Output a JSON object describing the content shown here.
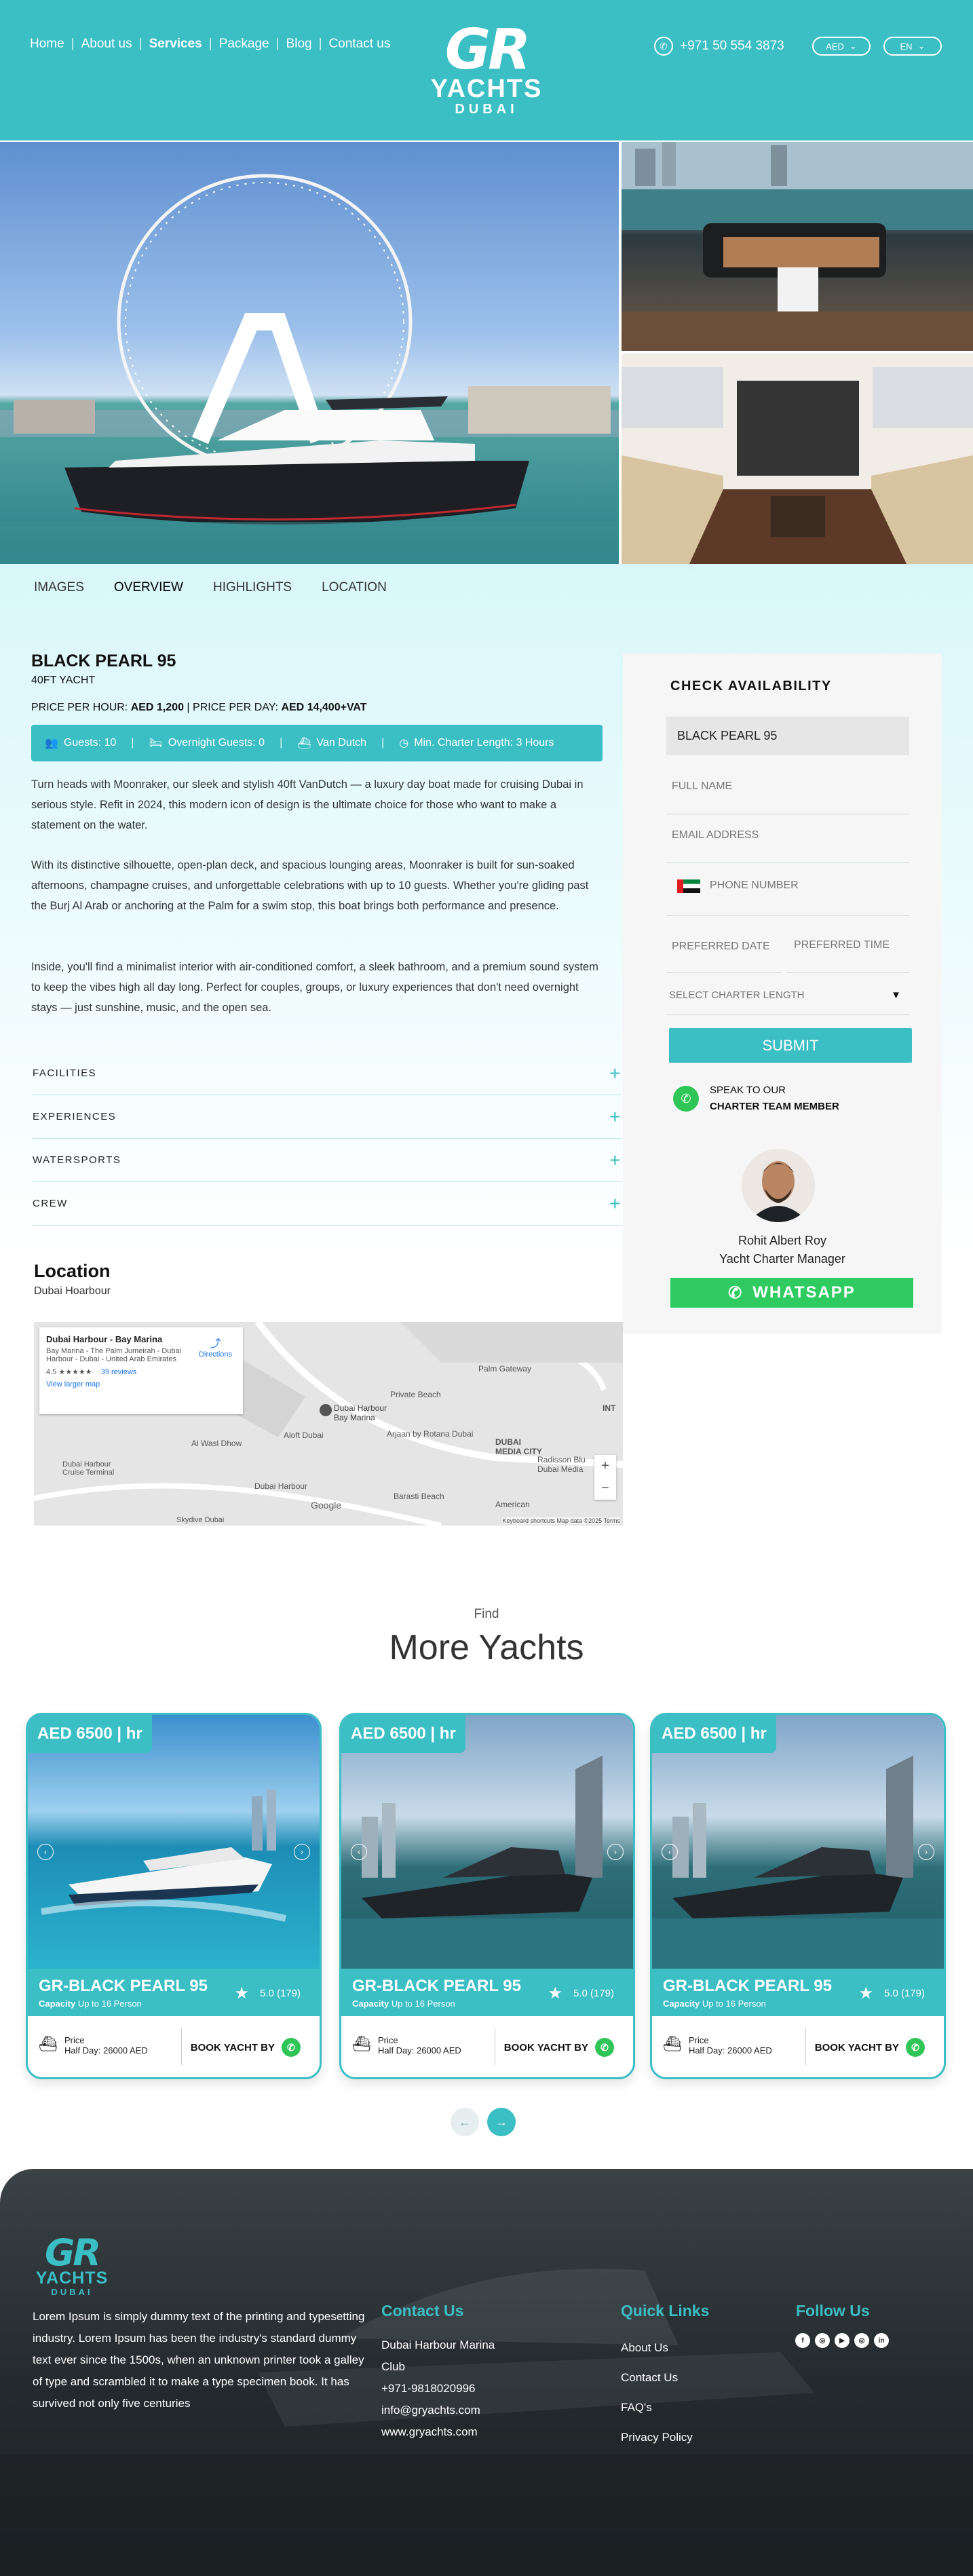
{
  "header": {
    "nav": [
      "Home",
      "About us",
      "Services",
      "Package",
      "Blog",
      "Contact us"
    ],
    "logo": {
      "mark": "GR",
      "line1": "YACHTS",
      "line2": "DUBAI"
    },
    "phone": "+971 50 554 3873",
    "currency": "AED",
    "language": "EN"
  },
  "tabs": [
    "IMAGES",
    "OVERVIEW",
    "HIGHLIGHTS",
    "LOCATION"
  ],
  "yacht": {
    "name": "BLACK PEARL 95",
    "length": "40FT YACHT",
    "price_hour_label": "PRICE PER HOUR:",
    "price_hour": "AED 1,200",
    "price_day_label": "PRICE PER DAY:",
    "price_day": "AED 14,400+VAT",
    "specs": [
      "Guests: 10",
      "Overnight Guests: 0",
      "Van Dutch",
      "Min. Charter Length: 3 Hours"
    ],
    "paragraphs": [
      "Turn heads with Moonraker, our sleek and stylish 40ft VanDutch — a luxury day boat made for cruising Dubai in serious style. Refit in 2024, this modern icon of design is the ultimate choice for those who want to make a statement on the water.",
      "With its distinctive silhouette, open-plan deck, and spacious lounging areas, Moonraker is built for sun-soaked afternoons, champagne cruises, and unforgettable celebrations with up to 10 guests. Whether you're gliding past the Burj Al Arab or anchoring at the Palm for a swim stop, this boat brings both performance and presence.",
      "Inside, you'll find a minimalist interior with air-conditioned comfort, a sleek bathroom, and a premium sound system to keep the vibes high all day long. Perfect for couples, groups, or luxury experiences that don't need overnight stays — just sunshine, music, and the open sea."
    ]
  },
  "accordion": [
    "FACILITIES",
    "EXPERIENCES",
    "WATERSPORTS",
    "CREW"
  ],
  "location": {
    "title": "Location",
    "subtitle": "Dubai Hoarbour",
    "map": {
      "place": "Dubai Harbour - Bay Marina",
      "address": "Bay Marina - The Palm Jumeirah - Dubai Harbour - Dubai - United Arab Emirates",
      "rating": "4.5 ★★★★★",
      "reviews": "39 reviews",
      "directions": "Directions",
      "larger": "View larger map",
      "labels": [
        "Palm Gateway",
        "Private Beach",
        "Dubai Harbour Bay Marina",
        "Al Wasl Dhow",
        "Aloft Dubai",
        "Dubai Harbour Cruise Terminal",
        "Arjaan by Rotana Dubai",
        "DUBAI MEDIA CITY",
        "Radisson Blu Dubai Media",
        "Dubai Harbour",
        "Barasti Beach",
        "Google",
        "American",
        "Skydive Dubai",
        "INT"
      ],
      "footer": "Keyboard shortcuts   Map data ©2025   Terms"
    }
  },
  "booking": {
    "heading": "CHECK AVAILABILITY",
    "selected_yacht": "BLACK PEARL 95",
    "full_name": "FULL NAME",
    "email": "EMAIL ADDRESS",
    "phone": "PHONE NUMBER",
    "date": "PREFERRED DATE",
    "time": "PREFERRED TIME",
    "length": "SELECT CHARTER LENGTH",
    "submit": "SUBMIT",
    "speak1": "SPEAK TO OUR",
    "speak2": "CHARTER TEAM MEMBER",
    "agent_name": "Rohit Albert Roy",
    "agent_role": "Yacht Charter Manager",
    "whatsapp": "WHATSAPP"
  },
  "more": {
    "kicker": "Find",
    "title": "More Yachts",
    "cards": [
      {
        "badge": "AED 6500 | hr",
        "name": "GR-BLACK PEARL 95",
        "cap_label": "Capacity",
        "cap": "Up to 16 Person",
        "rating": "5.0 (179)",
        "price_label": "Price",
        "price": "Half Day: 26000 AED",
        "book": "BOOK YACHT BY"
      },
      {
        "badge": "AED 6500 | hr",
        "name": "GR-BLACK PEARL 95",
        "cap_label": "Capacity",
        "cap": "Up to 16 Person",
        "rating": "5.0 (179)",
        "price_label": "Price",
        "price": "Half Day: 26000 AED",
        "book": "BOOK YACHT BY"
      },
      {
        "badge": "AED 6500 | hr",
        "name": "GR-BLACK PEARL 95",
        "cap_label": "Capacity",
        "cap": "Up to 16 Person",
        "rating": "5.0 (179)",
        "price_label": "Price",
        "price": "Half Day: 26000 AED",
        "book": "BOOK YACHT BY"
      }
    ],
    "prev": "←",
    "next": "→"
  },
  "footer": {
    "logo": {
      "mark": "GR",
      "line1": "YACHTS",
      "line2": "DUBAI"
    },
    "about": "Lorem Ipsum is simply dummy text of the printing and typesetting industry. Lorem Ipsum has been the industry's standard dummy text ever since the 1500s, when an unknown printer took a galley of type and scrambled it to make a type specimen book. It has survived not only five centuries",
    "contact_title": "Contact Us",
    "contact": [
      "Dubai Harbour Marina",
      "Club",
      "+971-9818020996",
      "info@gryachts.com",
      "www.gryachts.com"
    ],
    "links_title": "Quick Links",
    "links": [
      "About Us",
      "Contact Us",
      "FAQ's",
      "Privacy Policy"
    ],
    "follow_title": "Follow Us",
    "social": [
      "f",
      "◎",
      "▶",
      "◎",
      "in"
    ]
  },
  "colors": {
    "accent": "#3bbec4",
    "whatsapp": "#2fc557",
    "footer": "#23292c"
  }
}
